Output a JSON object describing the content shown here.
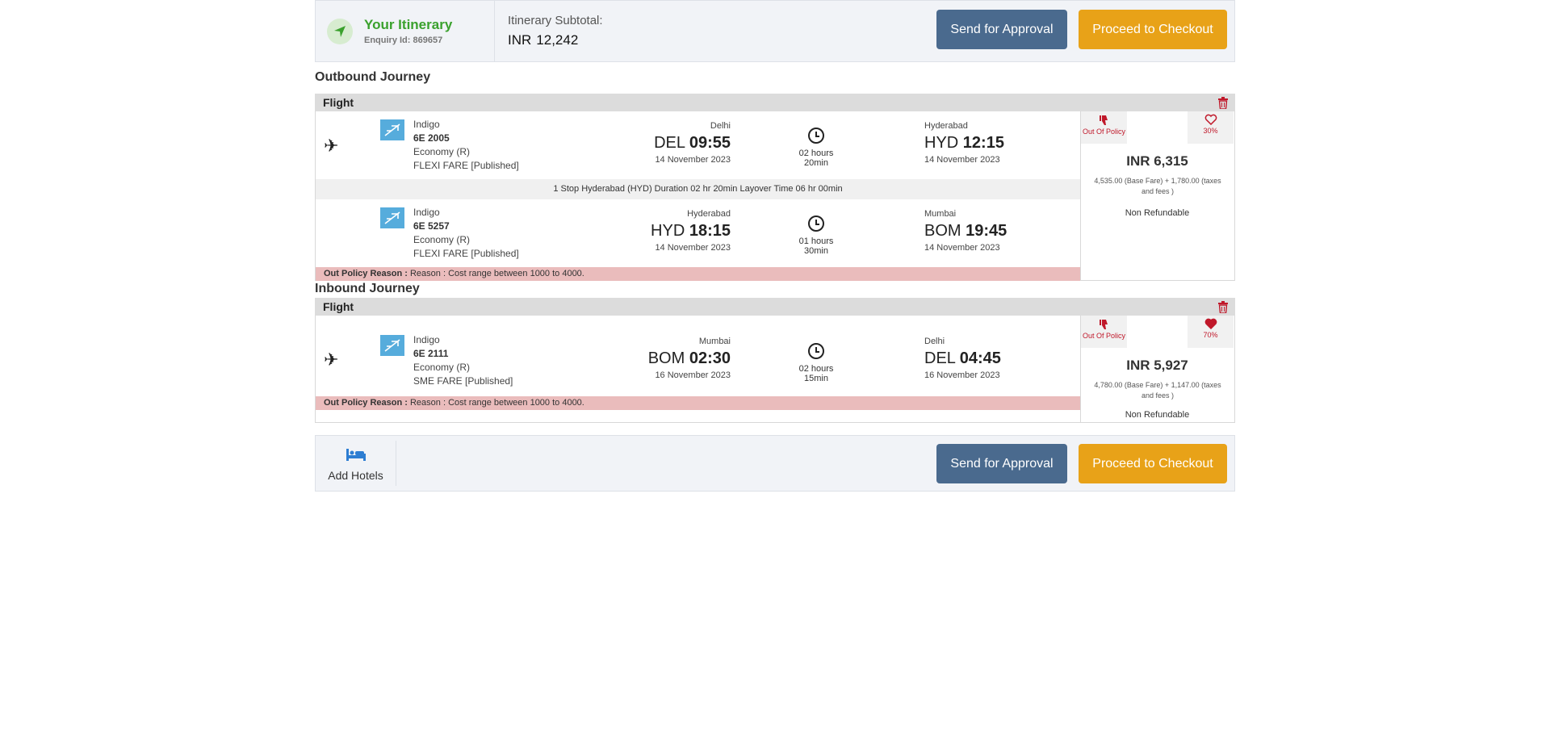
{
  "header": {
    "title": "Your Itinerary",
    "enquiry": "Enquiry Id: 869657",
    "subtotal_label": "Itinerary Subtotal:",
    "subtotal_currency": "INR",
    "subtotal_value": "12,242",
    "send_for_approval": "Send for Approval",
    "proceed_to_checkout": "Proceed to Checkout"
  },
  "outbound": {
    "title": "Outbound Journey",
    "section_label": "Flight",
    "legs": [
      {
        "airline": "Indigo",
        "flight_no": "6E 2005",
        "cabin": "Economy (R)",
        "fare_type": "FLEXI FARE [Published]",
        "dep_city": "Delhi",
        "dep_code": "DEL",
        "dep_time": "09:55",
        "dep_date": "14 November 2023",
        "duration": "02 hours 20min",
        "arr_city": "Hyderabad",
        "arr_code": "HYD",
        "arr_time": "12:15",
        "arr_date": "14 November 2023"
      },
      {
        "airline": "Indigo",
        "flight_no": "6E 5257",
        "cabin": "Economy (R)",
        "fare_type": "FLEXI FARE [Published]",
        "dep_city": "Hyderabad",
        "dep_code": "HYD",
        "dep_time": "18:15",
        "dep_date": "14 November 2023",
        "duration": "01 hours 30min",
        "arr_city": "Mumbai",
        "arr_code": "BOM",
        "arr_time": "19:45",
        "arr_date": "14 November 2023"
      }
    ],
    "stop_info": "1 Stop Hyderabad (HYD) Duration 02 hr 20min Layover Time 06 hr 00min",
    "policy_label": "Out Policy Reason :",
    "policy_reason": "Reason : Cost range between 1000 to 4000.",
    "out_of_policy": "Out Of Policy",
    "favourite_pct": "30%",
    "price": "INR 6,315",
    "breakdown": "4,535.00 (Base Fare) + 1,780.00 (taxes and fees )",
    "refund": "Non Refundable"
  },
  "inbound": {
    "title": "Inbound Journey",
    "section_label": "Flight",
    "legs": [
      {
        "airline": "Indigo",
        "flight_no": "6E 2111",
        "cabin": "Economy (R)",
        "fare_type": "SME FARE [Published]",
        "dep_city": "Mumbai",
        "dep_code": "BOM",
        "dep_time": "02:30",
        "dep_date": "16 November 2023",
        "duration": "02 hours 15min",
        "arr_city": "Delhi",
        "arr_code": "DEL",
        "arr_time": "04:45",
        "arr_date": "16 November 2023"
      }
    ],
    "policy_label": "Out Policy Reason :",
    "policy_reason": "Reason : Cost range between 1000 to 4000.",
    "out_of_policy": "Out Of Policy",
    "favourite_pct": "70%",
    "price": "INR 5,927",
    "breakdown": "4,780.00 (Base Fare) + 1,147.00 (taxes and fees )",
    "refund": "Non Refundable"
  },
  "footer": {
    "add_hotels": "Add Hotels",
    "send_for_approval": "Send for Approval",
    "proceed_to_checkout": "Proceed to Checkout"
  },
  "colors": {
    "accent_green": "#3aa12d",
    "approve_button": "#4a6a8e",
    "checkout_button": "#e8a218",
    "policy_bg": "#eabcbc",
    "policy_icon": "#c0182a"
  }
}
